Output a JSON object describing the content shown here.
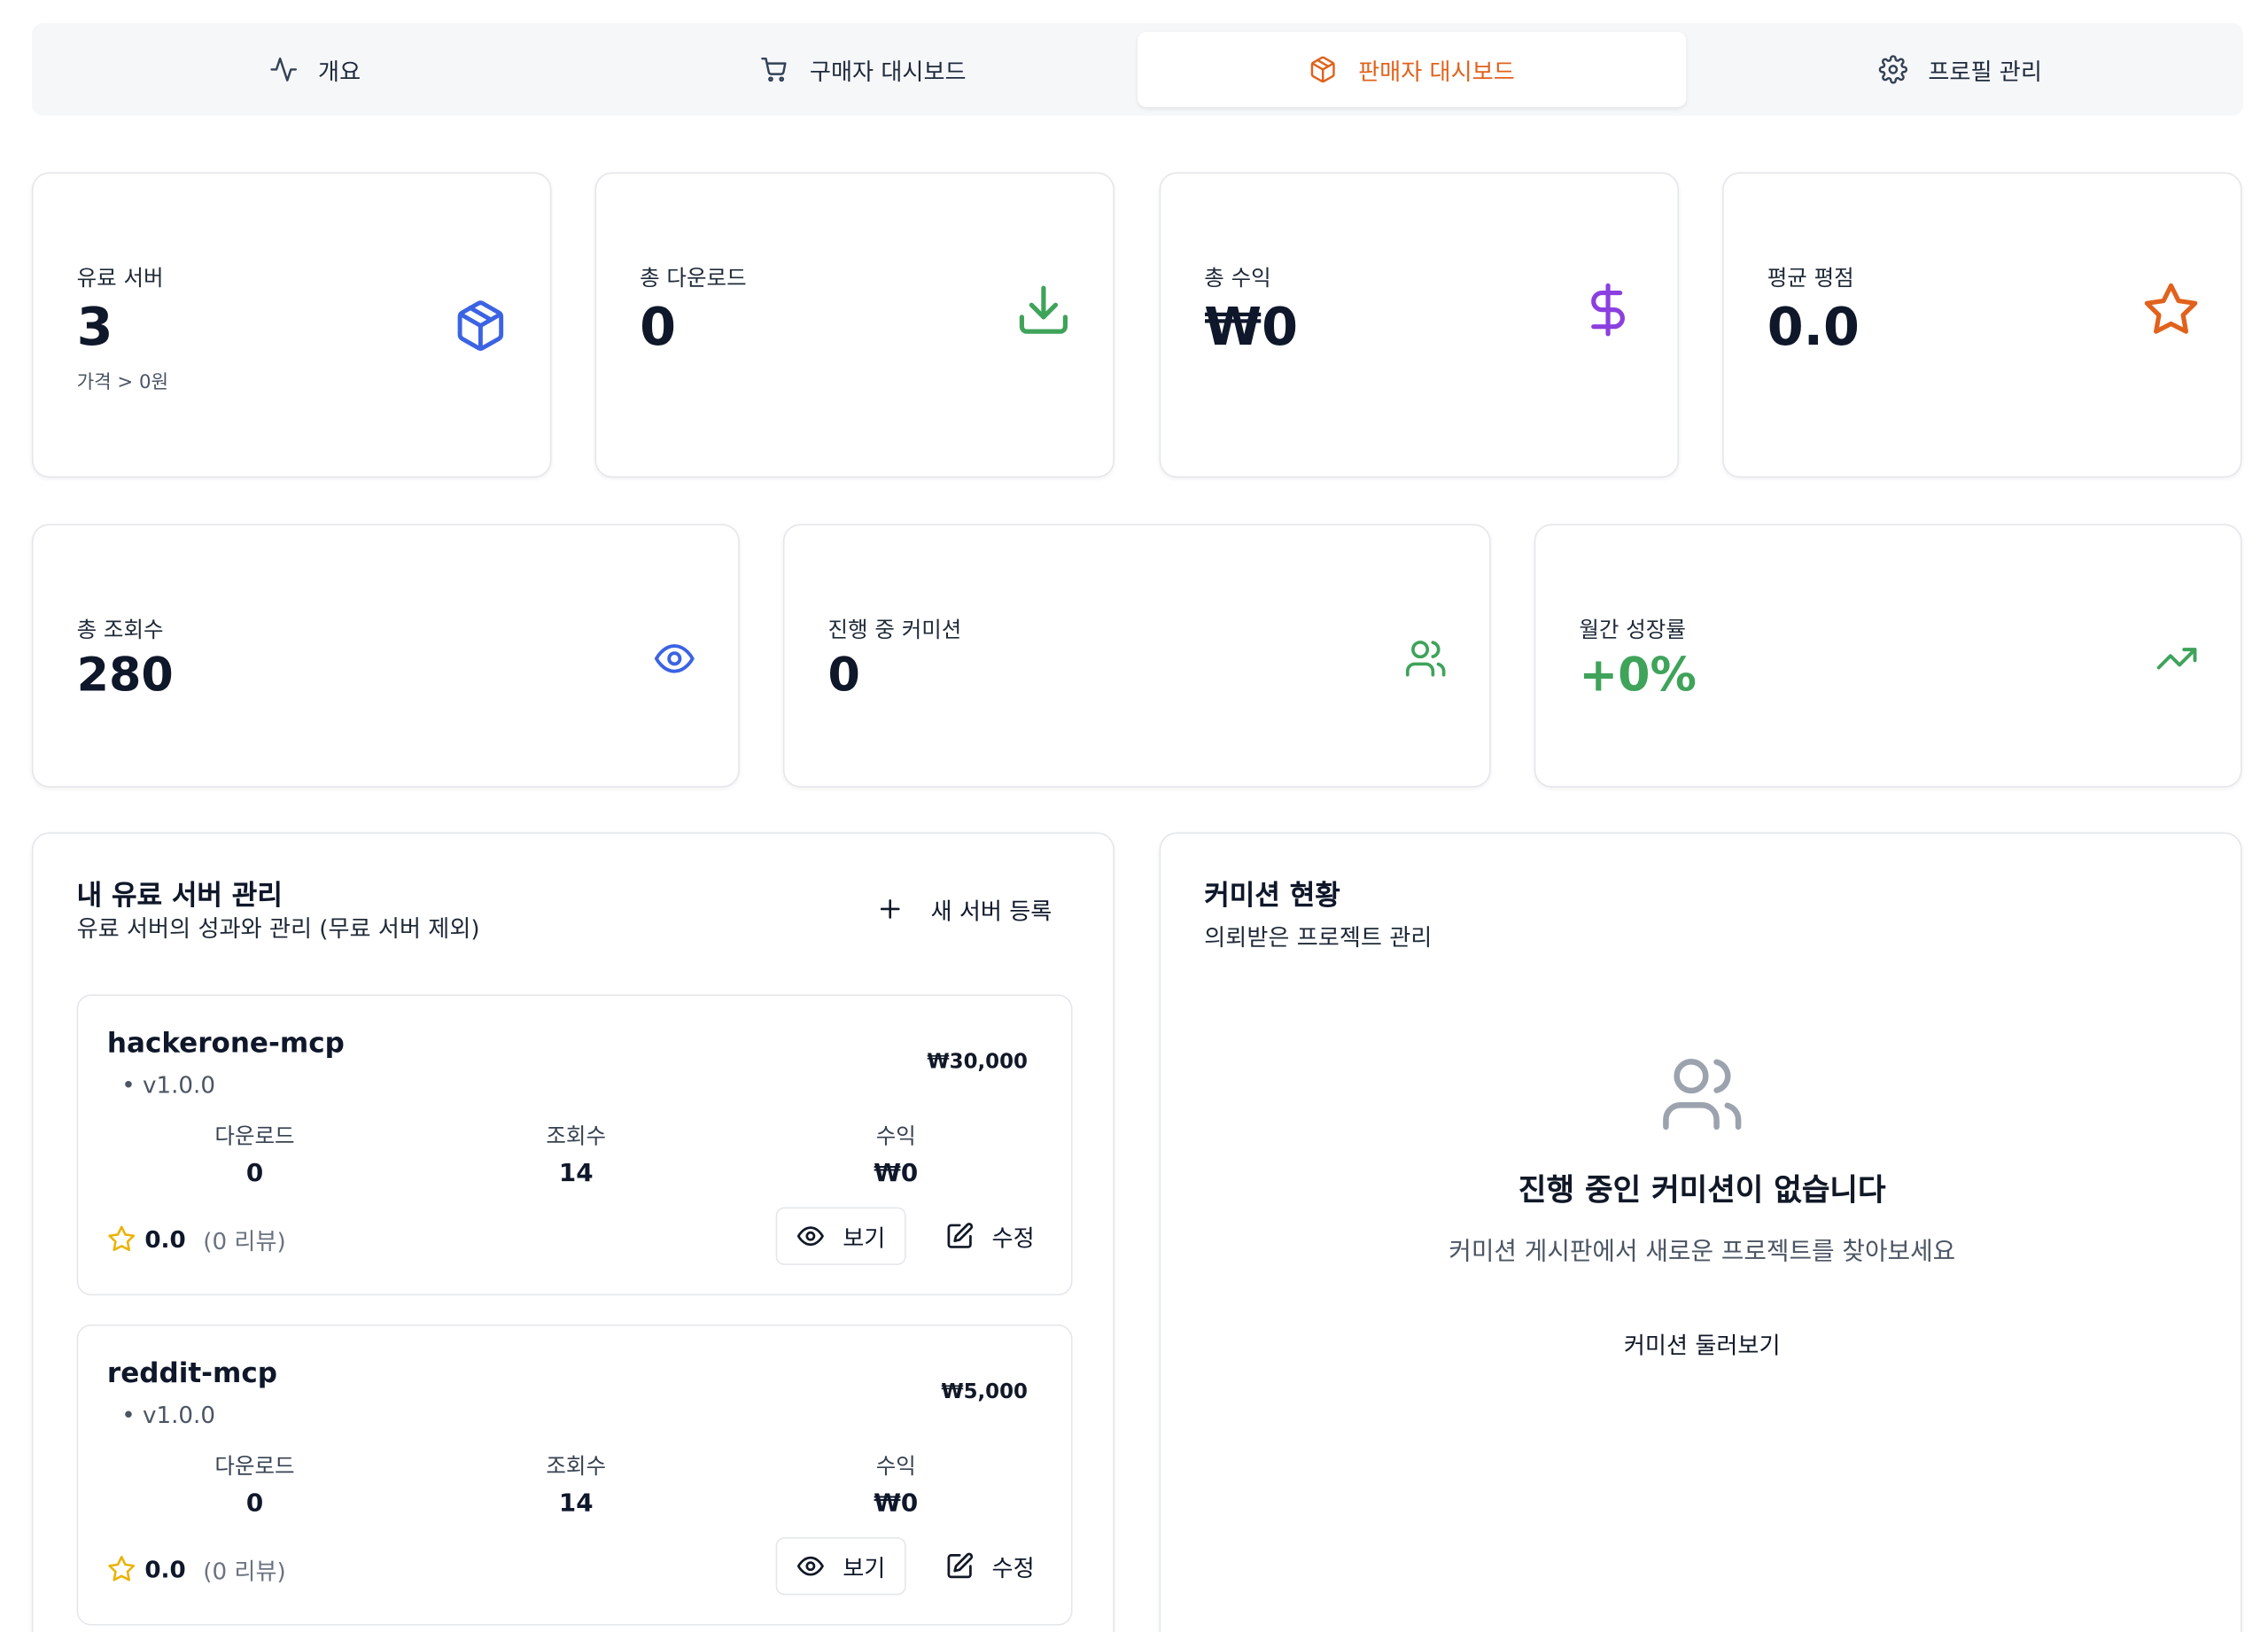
{
  "tabs": [
    {
      "label": "개요",
      "icon": "activity-icon"
    },
    {
      "label": "구매자 대시보드",
      "icon": "cart-icon"
    },
    {
      "label": "판매자 대시보드",
      "icon": "package-icon",
      "active": true
    },
    {
      "label": "프로필 관리",
      "icon": "gear-icon"
    }
  ],
  "stats_top": [
    {
      "label": "유료 서버",
      "value": "3",
      "sub": "가격 > 0원",
      "icon": "package-icon",
      "color": "#3b63e3"
    },
    {
      "label": "총 다운로드",
      "value": "0",
      "icon": "download-icon",
      "color": "#3fa35a"
    },
    {
      "label": "총 수익",
      "value": "₩0",
      "icon": "dollar-icon",
      "color": "#8b3fe0"
    },
    {
      "label": "평균 평점",
      "value": "0.0",
      "icon": "star-icon",
      "color": "#e0621c"
    }
  ],
  "stats_mid": [
    {
      "label": "총 조회수",
      "value": "280",
      "icon": "eye-icon",
      "color": "#3b63e3"
    },
    {
      "label": "진행 중 커미션",
      "value": "0",
      "icon": "users-icon",
      "color": "#3fa35a"
    },
    {
      "label": "월간 성장률",
      "value": "+0%",
      "icon": "trending-up-icon",
      "color": "#3fa35a"
    }
  ],
  "servers_panel": {
    "title": "내 유료 서버 관리",
    "desc": "유료 서버의 성과와 관리 (무료 서버 제외)",
    "new_button": "새 서버 등록",
    "metric_labels": {
      "downloads": "다운로드",
      "views": "조회수",
      "revenue": "수익"
    },
    "view_label": "보기",
    "edit_label": "수정",
    "servers": [
      {
        "name": "hackerone-mcp",
        "version": "v1.0.0",
        "price": "₩30,000",
        "downloads": "0",
        "views": "14",
        "revenue": "₩0",
        "rating": "0.0",
        "reviews": "(0 리뷰)"
      },
      {
        "name": "reddit-mcp",
        "version": "v1.0.0",
        "price": "₩5,000",
        "downloads": "0",
        "views": "14",
        "revenue": "₩0",
        "rating": "0.0",
        "reviews": "(0 리뷰)"
      }
    ]
  },
  "commission_panel": {
    "title": "커미션 현황",
    "desc": "의뢰받은 프로젝트 관리",
    "empty_title": "진행 중인 커미션이 없습니다",
    "empty_desc": "커미션 게시판에서 새로운 프로젝트를 찾아보세요",
    "browse_button": "커미션 둘러보기"
  }
}
